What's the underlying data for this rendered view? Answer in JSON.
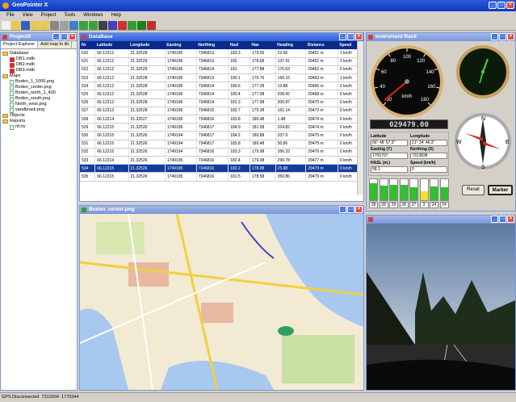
{
  "app": {
    "title": "GeoPointer X"
  },
  "menu": [
    "File",
    "View",
    "Project",
    "Tools",
    "Windows",
    "Help"
  ],
  "toolbar_icons": [
    "new-icon",
    "open-icon",
    "save-icon",
    "folder-icon",
    "folder-open-icon",
    "print-icon",
    "settings-icon",
    "table-icon",
    "chart-icon",
    "map-icon",
    "camera-icon",
    "gps-icon",
    "flag-icon",
    "check-icon",
    "play-icon",
    "pen-icon"
  ],
  "project": {
    "title": "ProjectX",
    "tabs": [
      "Project Explorer",
      "Add map to lib"
    ],
    "tree": [
      {
        "label": "Database",
        "type": "folder",
        "level": 0
      },
      {
        "label": "DB1.mdb",
        "type": "db",
        "level": 1
      },
      {
        "label": "DB2.mdb",
        "type": "db",
        "level": 1
      },
      {
        "label": "DB3.mdb",
        "type": "db",
        "level": 1
      },
      {
        "label": "Maps",
        "type": "folder",
        "level": 0
      },
      {
        "label": "Boden_1_1000.png",
        "type": "file",
        "level": 1
      },
      {
        "label": "Boden_center.png",
        "type": "file",
        "level": 1
      },
      {
        "label": "Boden_north_1_400",
        "type": "file",
        "level": 1
      },
      {
        "label": "Boden_south.png",
        "type": "file",
        "level": 1
      },
      {
        "label": "North_west.png",
        "type": "file",
        "level": 1
      },
      {
        "label": "sandbrask.png",
        "type": "file",
        "level": 1
      },
      {
        "label": "Objects",
        "type": "folder",
        "level": 0
      },
      {
        "label": "Reports",
        "type": "folder",
        "level": 0
      },
      {
        "label": "rtf.rtv",
        "type": "file",
        "level": 1
      }
    ]
  },
  "database": {
    "title": "DataBase",
    "columns": [
      "Nr",
      "Latitude",
      "Longitude",
      "Easting",
      "Northing",
      "Hasl",
      "Hae",
      "Heading",
      "Distance",
      "Speed"
    ],
    "rows": [
      [
        "520",
        "66.12212",
        "21.32528",
        "1749195",
        "7346813",
        "183.3",
        "179.55",
        "22.06",
        "29451 m",
        "1 km/h"
      ],
      [
        "521",
        "66.12212",
        "21.32529",
        "1749196",
        "7346813",
        "182",
        "178.68",
        "137.91",
        "29451 m",
        "1 km/h"
      ],
      [
        "522",
        "66.12212",
        "21.32529",
        "1749196",
        "7346814",
        "181",
        "177.88",
        "170.63",
        "29462 m",
        "0 km/h"
      ],
      [
        "523",
        "66.12212",
        "21.32528",
        "1749195",
        "7346813",
        "180.1",
        "176.76",
        "166.16",
        "29463 m",
        "1 km/h"
      ],
      [
        "524",
        "66.12212",
        "21.32528",
        "1749195",
        "7346814",
        "180.6",
        "177.28",
        "13.88",
        "29466 m",
        "2 km/h"
      ],
      [
        "525",
        "66.12212",
        "21.32528",
        "1749196",
        "7346814",
        "180.4",
        "177.08",
        "208.42",
        "29468 m",
        "0 km/h"
      ],
      [
        "526",
        "66.12212",
        "21.32528",
        "1749196",
        "7346814",
        "181.3",
        "177.98",
        "306.87",
        "29470 m",
        "0 km/h"
      ],
      [
        "527",
        "66.12213",
        "21.32528",
        "1749195",
        "7346815",
        "182.7",
        "179.38",
        "161.14",
        "29472 m",
        "0 km/h"
      ],
      [
        "528",
        "66.12214",
        "21.32527",
        "1749195",
        "7346816",
        "183.8",
        "180.48",
        "1.48",
        "29474 m",
        "0 km/h"
      ],
      [
        "529",
        "66.12215",
        "21.32526",
        "1749195",
        "7346817",
        "184.9",
        "181.58",
        "324.82",
        "29474 m",
        "0 km/h"
      ],
      [
        "530",
        "66.12215",
        "21.32526",
        "1749194",
        "7346817",
        "184.2",
        "180.88",
        "337.9",
        "29475 m",
        "0 km/h"
      ],
      [
        "531",
        "66.12215",
        "21.32526",
        "1749194",
        "7346817",
        "183.8",
        "180.48",
        "50.86",
        "29475 m",
        "0 km/h"
      ],
      [
        "532",
        "66.12215",
        "21.32526",
        "1749194",
        "7346816",
        "183.3",
        "179.98",
        "356.33",
        "29476 m",
        "0 km/h"
      ],
      [
        "533",
        "66.12214",
        "21.32526",
        "1749195",
        "7346816",
        "182.4",
        "179.08",
        "299.78",
        "29477 m",
        "0 km/h"
      ],
      [
        "534",
        "66.12215",
        "21.32526",
        "1749195",
        "7346816",
        "182.2",
        "178.88",
        "25.88",
        "29479 m",
        "0 km/h"
      ],
      [
        "535",
        "66.12215",
        "21.32526",
        "1749195",
        "7346816",
        "181.5",
        "178.58",
        "350.86",
        "29479 m",
        "0 km/h"
      ]
    ],
    "selected_row": 14
  },
  "instrument": {
    "title": "Instrument Rack",
    "speed_ticks": [
      "20",
      "40",
      "60",
      "80",
      "100",
      "120",
      "140",
      "160",
      "180"
    ],
    "speed_unit": "km/h",
    "speed_value_fraction": 0.02,
    "odometer": "029479.00",
    "compass_n": "N",
    "compass_s": "S",
    "compass_e": "E",
    "compass_w": "W",
    "fields": {
      "lat_label": "Latitude",
      "lat_value": "66° 48' 57.9\"",
      "lon_label": "Longitude",
      "lon_value": "21° 34' 46.3\"",
      "east_label": "Easting (Y)",
      "east_value": "1765707",
      "north_label": "Northing (X)",
      "north_value": "7313838",
      "hasl_label": "HASL (m.)",
      "hasl_value": "58.1",
      "speed_label": "Speed (km/h)",
      "speed_value": "0"
    },
    "bars": [
      {
        "label": "28",
        "level": 0.82
      },
      {
        "label": "28",
        "level": 0.7
      },
      {
        "label": "29",
        "level": 0.75
      },
      {
        "label": "28",
        "level": 0.74
      },
      {
        "label": "27",
        "level": 0.6
      },
      {
        "label": "3",
        "level": 0.42
      },
      {
        "label": "24",
        "level": 0.65
      },
      {
        "label": "24",
        "level": 0.6
      }
    ],
    "bar_colors": [
      "#30c030",
      "#30c030",
      "#30c030",
      "#30c030",
      "#30c030",
      "#f0e030",
      "#30c030",
      "#30c030"
    ],
    "reset": "Reset",
    "marker": "Marker"
  },
  "map": {
    "title": "Boden_center.png"
  },
  "camera": {
    "title": ""
  },
  "status": {
    "text": "GPS Disconnected",
    "north": "7312934",
    "east": "1770344"
  }
}
